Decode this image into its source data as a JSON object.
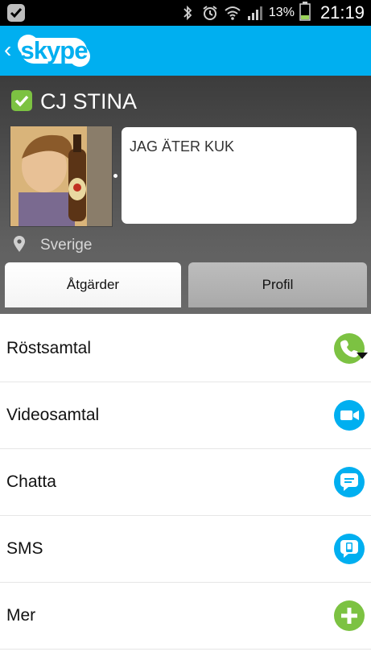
{
  "status_bar": {
    "battery_percent": "13%",
    "time": "21:19"
  },
  "header": {
    "back_icon": "chevron-left-icon",
    "logo_text": "skype",
    "brand_color": "#00aff0"
  },
  "profile": {
    "name": "CJ STINA",
    "mood_message": "JAG ÄTER KUK",
    "location": "Sverige",
    "status_color": "#7cc242"
  },
  "tabs": [
    {
      "label": "Åtgärder",
      "active": true
    },
    {
      "label": "Profil",
      "active": false
    }
  ],
  "actions": [
    {
      "label": "Röstsamtal",
      "icon": "phone-icon",
      "color": "#7cc242"
    },
    {
      "label": "Videosamtal",
      "icon": "video-camera-icon",
      "color": "#00aff0"
    },
    {
      "label": "Chatta",
      "icon": "chat-bubble-icon",
      "color": "#00aff0"
    },
    {
      "label": "SMS",
      "icon": "sms-icon",
      "color": "#00aff0"
    },
    {
      "label": "Mer",
      "icon": "plus-icon",
      "color": "#7cc242"
    }
  ]
}
